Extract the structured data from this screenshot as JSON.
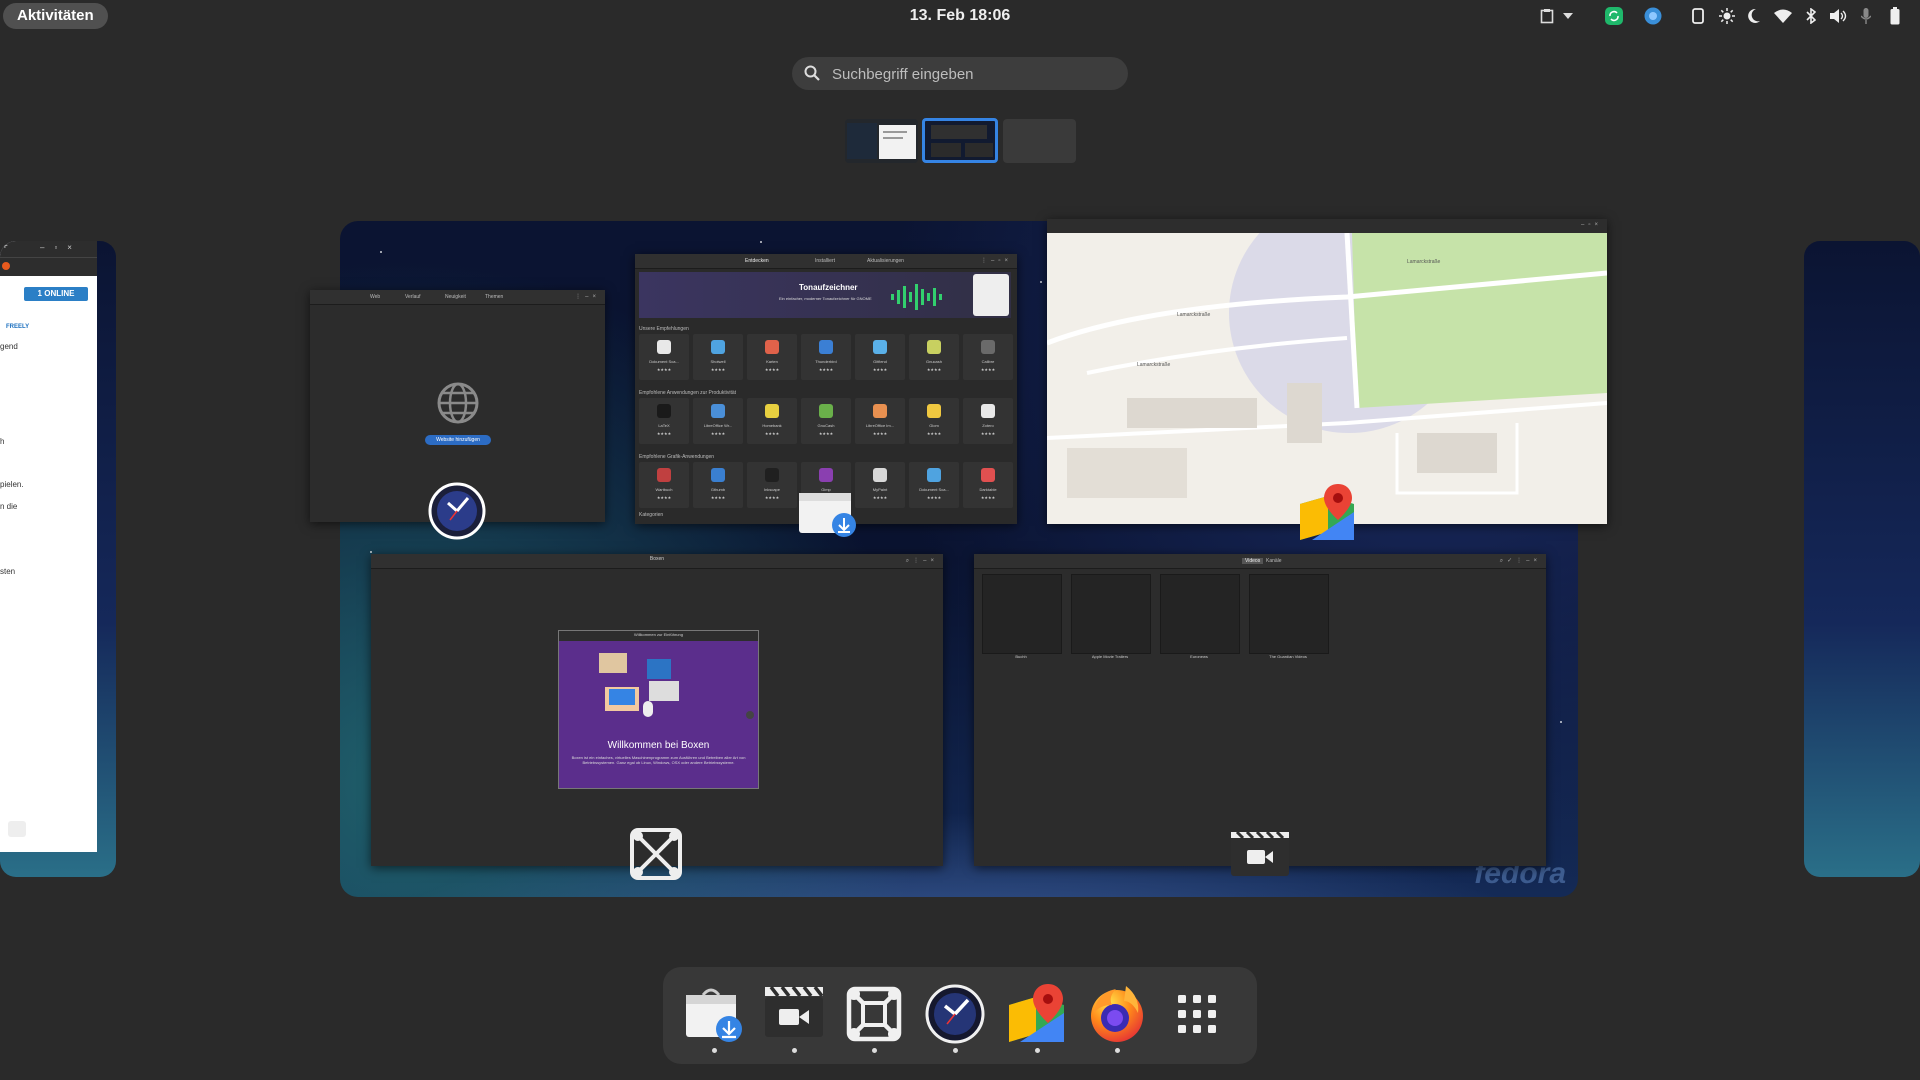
{
  "topbar": {
    "activities": "Aktivitäten",
    "clock": "13. Feb  18:06",
    "tray_icons": [
      "clipboard-icon",
      "dropdown-arrow-icon",
      "sync-icon",
      "app-indicator-icon",
      "phone-icon",
      "brightness-icon",
      "night-light-icon",
      "wifi-icon",
      "bluetooth-icon",
      "volume-icon",
      "microphone-icon",
      "battery-icon"
    ]
  },
  "search": {
    "placeholder": "Suchbegriff eingeben"
  },
  "workspaces": [
    "workspace-1",
    "workspace-2",
    "workspace-3"
  ],
  "windows": {
    "web": {
      "tabs": [
        "Web",
        "Verlauf",
        "Neuigkeit",
        "Themen"
      ],
      "button": "Website hinzufügen"
    },
    "software": {
      "tabs": [
        "Entdecken",
        "Installiert",
        "Aktualisierungen"
      ],
      "banner_title": "Tonaufzeichner",
      "banner_sub": "Ein einfacher, moderner Tonaufzeichner für GNOME",
      "section1": "Unsere Empfehlungen",
      "section2": "Empfohlene Anwendungen zur Produktivität",
      "section3": "Empfohlene Grafik-Anwendungen",
      "section4": "Kategorien",
      "row1": [
        "Dokument Sca...",
        "Shotwell",
        "Karten",
        "Thunderbird",
        "Gitfiend",
        "Gnucash",
        "Calibre"
      ],
      "row2": [
        "LaTeX",
        "LibreOffice Wr...",
        "Homebank",
        "GnuCash",
        "LibreOffice Im...",
        "Glom",
        "Zotero"
      ],
      "row3": [
        "Wartbuch",
        "Gthumb",
        "Inkscape",
        "Gimp",
        "MyPaint",
        "Dokument Sca...",
        "Darktable"
      ]
    },
    "maps": {
      "street": "Lamarckstraße"
    },
    "boxes": {
      "title": "Boxen",
      "dialog_title": "Willkommen zur Einführung",
      "welcome": "Willkommen bei Boxen",
      "welcome_text": "Boxen ist ein einfaches, virtuelles Maschinenprogramm zum Ausführen und Betreiben aller Art von Betriebssystemen. Ganz egal ob Linux, Windows, OSX oder andere Betriebssysteme."
    },
    "videos": {
      "tabs": [
        "Videos",
        "Kanäle"
      ],
      "items": [
        "Buchh",
        "Apple Movie Trailers",
        "Euronews",
        "The Guardian Videos"
      ]
    },
    "chat": {
      "online": "1 ONLINE",
      "brand": "FREELY",
      "lines": [
        "gend",
        "h",
        "pielen.",
        "n die",
        "sten"
      ]
    }
  },
  "dock": {
    "items": [
      "Software",
      "Videos",
      "Boxen",
      "Uhren",
      "Karten",
      "Firefox",
      "Anwendungen anzeigen"
    ],
    "running": [
      true,
      true,
      true,
      true,
      true,
      true,
      false
    ]
  }
}
